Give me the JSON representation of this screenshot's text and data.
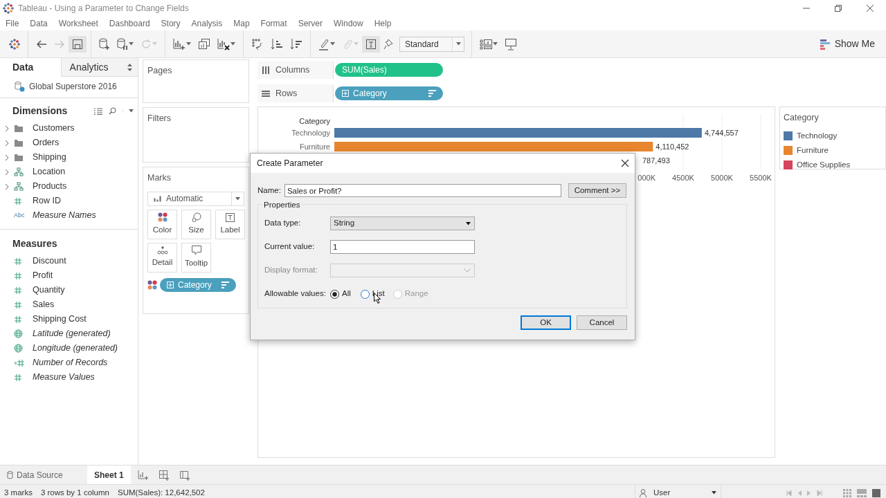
{
  "window": {
    "title": "Tableau - Using a Parameter to Change Fields"
  },
  "menu": [
    "File",
    "Data",
    "Worksheet",
    "Dashboard",
    "Story",
    "Analysis",
    "Map",
    "Format",
    "Server",
    "Window",
    "Help"
  ],
  "toolbar": {
    "items": [
      {
        "kind": "logo"
      },
      {
        "kind": "sep"
      },
      {
        "kind": "back",
        "disabled": false,
        "dropdown": false
      },
      {
        "kind": "forward",
        "disabled": true,
        "dropdown": false
      },
      {
        "kind": "save",
        "disabled": false,
        "dropdown": false,
        "selected": true
      },
      {
        "kind": "sep"
      },
      {
        "kind": "new-datasource",
        "disabled": false,
        "dropdown": false
      },
      {
        "kind": "pause",
        "disabled": false,
        "dropdown": true
      },
      {
        "kind": "refresh",
        "disabled": true,
        "dropdown": true
      },
      {
        "kind": "sep"
      },
      {
        "kind": "new-sheet",
        "disabled": false,
        "dropdown": true
      },
      {
        "kind": "duplicate",
        "disabled": false,
        "dropdown": false
      },
      {
        "kind": "clear",
        "disabled": false,
        "dropdown": true
      },
      {
        "kind": "sep"
      },
      {
        "kind": "swap",
        "disabled": false,
        "dropdown": false
      },
      {
        "kind": "sort-asc",
        "disabled": false,
        "dropdown": false
      },
      {
        "kind": "sort-desc",
        "disabled": false,
        "dropdown": false
      },
      {
        "kind": "sep"
      },
      {
        "kind": "highlight",
        "disabled": false,
        "dropdown": true
      },
      {
        "kind": "clip",
        "disabled": true,
        "dropdown": true
      },
      {
        "kind": "labels",
        "disabled": false,
        "dropdown": false,
        "selected": true
      },
      {
        "kind": "pin",
        "disabled": false,
        "dropdown": false
      },
      {
        "kind": "fit",
        "value": "Standard"
      },
      {
        "kind": "sep"
      },
      {
        "kind": "cards",
        "disabled": false,
        "dropdown": true
      },
      {
        "kind": "present",
        "disabled": false,
        "dropdown": false
      }
    ],
    "show_me": "Show Me"
  },
  "data_pane": {
    "tabs": [
      {
        "label": "Data",
        "selected": true
      },
      {
        "label": "Analytics",
        "selected": false
      }
    ],
    "datasource": "Global Superstore 2016",
    "dimensions": {
      "title": "Dimensions",
      "items": [
        {
          "label": "Customers",
          "kind": "folder",
          "expandable": true,
          "generated": false
        },
        {
          "label": "Orders",
          "kind": "folder",
          "expandable": true,
          "generated": false
        },
        {
          "label": "Shipping",
          "kind": "folder",
          "expandable": true,
          "generated": false
        },
        {
          "label": "Location",
          "kind": "hierarchy",
          "expandable": true,
          "generated": false
        },
        {
          "label": "Products",
          "kind": "hierarchy",
          "expandable": true,
          "generated": false
        },
        {
          "label": "Row ID",
          "kind": "number",
          "expandable": false,
          "generated": false
        },
        {
          "label": "Measure Names",
          "kind": "text",
          "type_label": "Abc",
          "expandable": false,
          "generated": true
        }
      ]
    },
    "measures": {
      "title": "Measures",
      "items": [
        {
          "label": "Discount",
          "kind": "number",
          "generated": false
        },
        {
          "label": "Profit",
          "kind": "number",
          "generated": false
        },
        {
          "label": "Quantity",
          "kind": "number",
          "generated": false
        },
        {
          "label": "Sales",
          "kind": "number",
          "generated": false
        },
        {
          "label": "Shipping Cost",
          "kind": "number",
          "generated": false
        },
        {
          "label": "Latitude (generated)",
          "kind": "geo",
          "generated": true
        },
        {
          "label": "Longitude (generated)",
          "kind": "geo",
          "generated": true
        },
        {
          "label": "Number of Records",
          "kind": "count",
          "generated": true
        },
        {
          "label": "Measure Values",
          "kind": "number",
          "generated": true
        }
      ]
    }
  },
  "cards": {
    "pages": {
      "title": "Pages"
    },
    "filters": {
      "title": "Filters"
    },
    "marks": {
      "title": "Marks",
      "mark_type": "Automatic",
      "buttons": [
        {
          "label": "Color",
          "kind": "color"
        },
        {
          "label": "Size",
          "kind": "size"
        },
        {
          "label": "Label",
          "kind": "label"
        },
        {
          "label": "Detail",
          "kind": "detail"
        },
        {
          "label": "Tooltip",
          "kind": "tooltip"
        }
      ],
      "pill": {
        "label": "Category",
        "kind": "dimension"
      }
    }
  },
  "shelves": [
    {
      "label": "Columns",
      "kind": "columns",
      "pill": {
        "label": "SUM(Sales)",
        "kind": "measure",
        "sorted": false
      }
    },
    {
      "label": "Rows",
      "kind": "rows",
      "pill": {
        "label": "Category",
        "kind": "dimension",
        "sorted": true
      }
    }
  ],
  "view": {
    "row_header": "Category",
    "partial_label": "787,493",
    "partial_tick_label": "000K",
    "legend_title": "Category",
    "chart_data": {
      "type": "bar",
      "orientation": "horizontal",
      "grid": true,
      "xlim": [
        0,
        5500
      ],
      "categories": [
        "Technology",
        "Furniture"
      ],
      "series": [
        {
          "name": "Technology",
          "color": "#4e79a7",
          "values": [
            4740,
            null
          ]
        },
        {
          "name": "Furniture",
          "color": "#e8862f",
          "values": [
            null,
            4110
          ]
        },
        {
          "name": "Office Supplies",
          "color": "#d5435c",
          "values": [
            null,
            null
          ]
        }
      ],
      "value_labels": [
        "4,744,557",
        "4,110,452"
      ],
      "xticks": [
        {
          "value": 4500,
          "label": "4500K"
        },
        {
          "value": 5000,
          "label": "5000K"
        },
        {
          "value": 5500,
          "label": "5500K"
        }
      ]
    }
  },
  "dialog": {
    "title": "Create Parameter",
    "name_label": "Name:",
    "name_value": "Sales or Profit?",
    "comment_button": "Comment >>",
    "group_title": "Properties",
    "fields": [
      {
        "label": "Data type:",
        "kind": "select",
        "value": "String",
        "disabled": false
      },
      {
        "label": "Current value:",
        "kind": "input",
        "value": "1",
        "disabled": false
      },
      {
        "label": "Display format:",
        "kind": "select",
        "disabled": true
      }
    ],
    "allowable": {
      "label": "Allowable values:",
      "options": [
        {
          "label": "All",
          "selected": true,
          "disabled": false,
          "hovered": false
        },
        {
          "label": "List",
          "selected": false,
          "disabled": false,
          "hovered": true
        },
        {
          "label": "Range",
          "selected": false,
          "disabled": true,
          "hovered": false
        }
      ]
    },
    "buttons": [
      {
        "label": "OK",
        "default": true
      },
      {
        "label": "Cancel",
        "default": false
      }
    ]
  },
  "sheet_tabs": [
    {
      "label": "Data Source",
      "kind": "datasource",
      "selected": false
    },
    {
      "label": "Sheet 1",
      "kind": "sheet",
      "selected": true
    }
  ],
  "status_bar": {
    "items": [
      "3 marks",
      "3 rows by 1 column",
      "SUM(Sales): 12,642,502"
    ],
    "user": "User"
  }
}
